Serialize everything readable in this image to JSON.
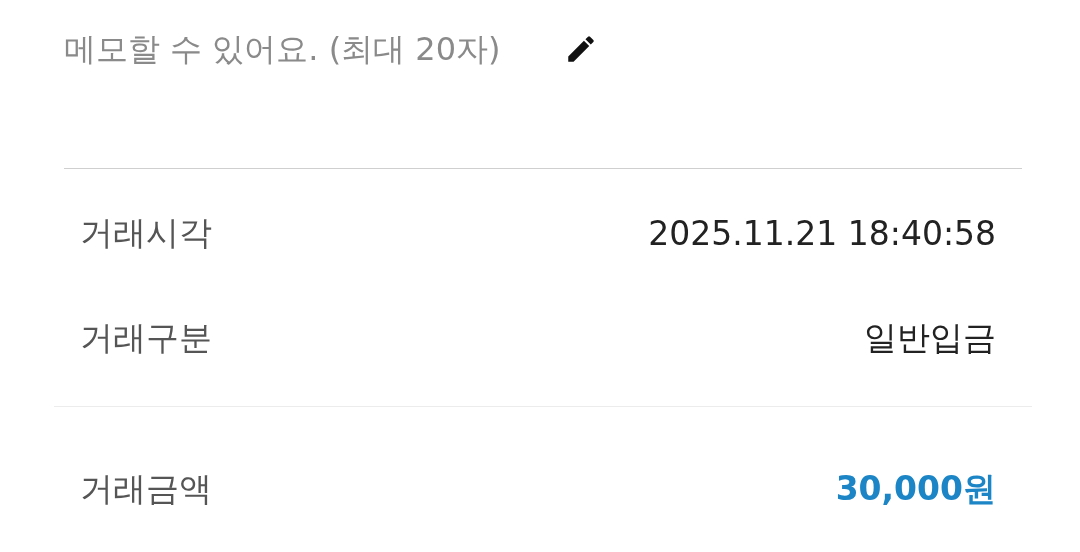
{
  "memo": {
    "placeholder": "메모할 수 있어요. (최대 20자)"
  },
  "details": [
    {
      "label": "거래시각",
      "value": "2025.11.21 18:40:58",
      "kind": "plain"
    },
    {
      "label": "거래구분",
      "value": "일반입금",
      "kind": "plain"
    }
  ],
  "amount": {
    "label": "거래금액",
    "value": "30,000원",
    "kind": "highlight"
  }
}
